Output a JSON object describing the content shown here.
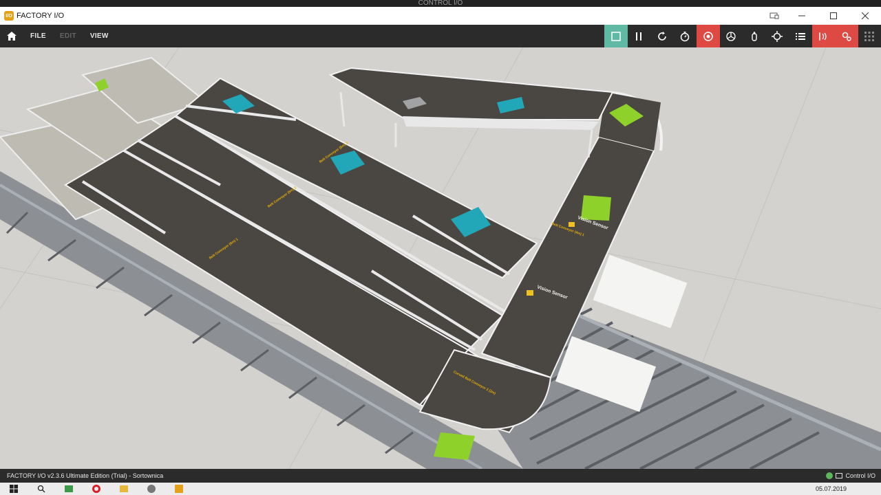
{
  "os": {
    "window_label": "CONTROL I/O"
  },
  "window": {
    "app_icon_text": "I/O",
    "title": "FACTORY I/O"
  },
  "menu": {
    "file": "FILE",
    "edit": "EDIT",
    "view": "VIEW"
  },
  "toolbar_icons": [
    "stop-icon",
    "pause-icon",
    "reset-icon",
    "timer-icon",
    "camera-icon",
    "sensor-view-icon",
    "hand-icon",
    "target-icon",
    "list-icon",
    "driver-icon",
    "settings-icon",
    "grid-icon"
  ],
  "scene": {
    "labels": {
      "vision_sensor_1": "Vision Sensor",
      "vision_sensor_2": "Vision Sensor",
      "belt_conveyor_4m": "Belt Conveyor (4m) 1",
      "belt_conveyor_6m_1": "Belt Conveyor (6m) 1",
      "belt_conveyor_6m_2": "Belt Conveyor (6m) 2",
      "belt_conveyor_6m_3": "Belt Conveyor (6m) 3",
      "curved_belt": "Curved Belt Conveyor 2 (2m)"
    },
    "colors": {
      "floor": "#d4d2ce",
      "belt": "#4a4642",
      "teal_box": "#22a7b8",
      "green_box": "#8ed12a"
    }
  },
  "status": {
    "text": "FACTORY I/O v2.3.6 Ultimate Edition (Trial) - Sortownica",
    "right_label": "Control I/O"
  },
  "taskbar": {
    "date": "05.07.2019"
  }
}
